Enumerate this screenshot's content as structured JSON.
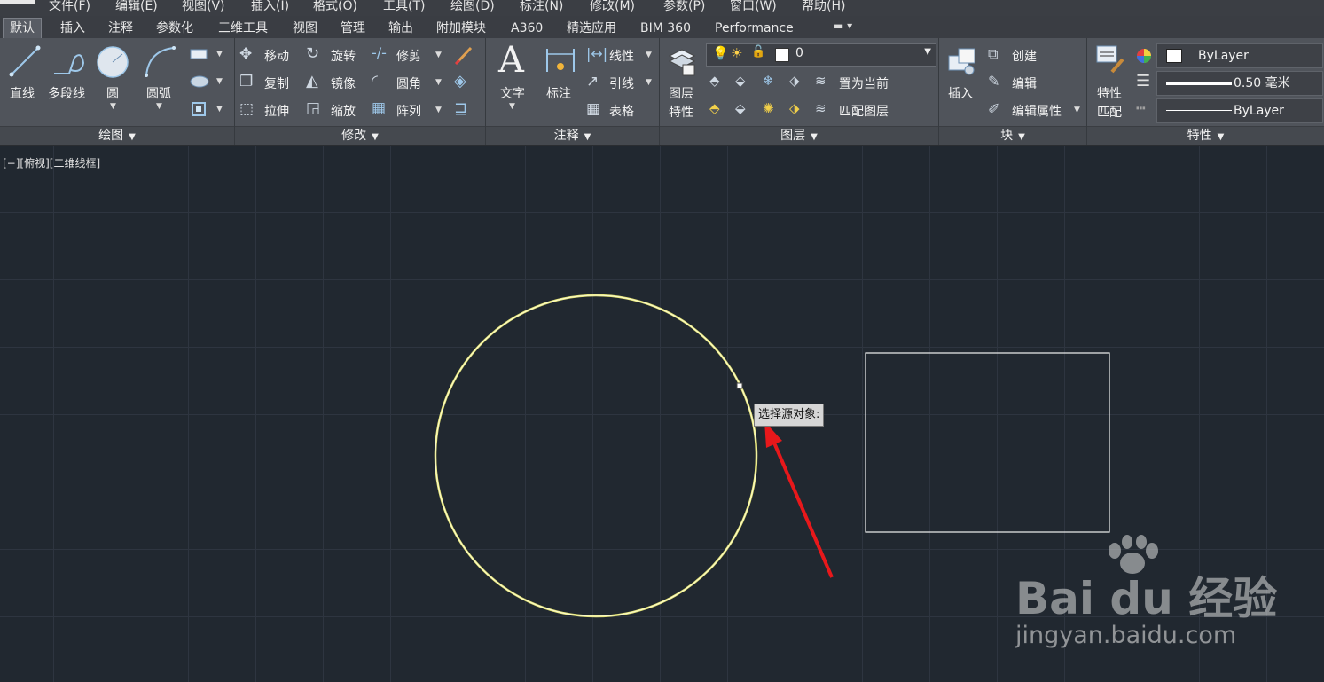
{
  "menu": [
    "文件(F)",
    "编辑(E)",
    "视图(V)",
    "插入(I)",
    "格式(O)",
    "工具(T)",
    "绘图(D)",
    "标注(N)",
    "修改(M)",
    "参数(P)",
    "窗口(W)",
    "帮助(H)"
  ],
  "tabs": [
    "默认",
    "插入",
    "注释",
    "参数化",
    "三维工具",
    "视图",
    "管理",
    "输出",
    "附加模块",
    "A360",
    "精选应用",
    "BIM 360",
    "Performance"
  ],
  "draw_panel": {
    "title": "绘图",
    "line": "直线",
    "polyline": "多段线",
    "circle": "圆",
    "arc": "圆弧"
  },
  "modify_panel": {
    "title": "修改",
    "move": "移动",
    "rotate": "旋转",
    "trim": "修剪",
    "copy": "复制",
    "mirror": "镜像",
    "fillet": "圆角",
    "stretch": "拉伸",
    "scale": "缩放",
    "array": "阵列"
  },
  "annotation_panel": {
    "title": "注释",
    "text": "文字",
    "dimension": "标注",
    "linear": "线性",
    "leader": "引线",
    "table": "表格"
  },
  "layers_panel": {
    "title": "图层",
    "layer_properties_line1": "图层",
    "layer_properties_line2": "特性",
    "current_layer": "0",
    "set_current": "置为当前",
    "match_layer": "匹配图层"
  },
  "block_panel": {
    "title": "块",
    "insert": "插入",
    "create": "创建",
    "edit": "编辑",
    "edit_attributes": "编辑属性"
  },
  "properties_panel": {
    "title": "特性",
    "match_line1": "特性",
    "match_line2": "匹配",
    "color": "ByLayer",
    "lineweight": "0.50 毫米",
    "linetype": "ByLayer"
  },
  "viewport_label": "[−][俯视][二维线框]",
  "tooltip": "选择源对象:",
  "watermark": {
    "logo": "Bai du 经验",
    "url": "jingyan.baidu.com"
  },
  "colors": {
    "accent_circle": "#e8e87a",
    "annotation_arrow": "#e8181b",
    "canvas_bg": "#212830"
  }
}
